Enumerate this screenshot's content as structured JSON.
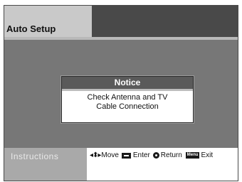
{
  "screen": {
    "title": "Auto Setup"
  },
  "notice": {
    "header": "Notice",
    "line1": "Check Antenna and TV",
    "line2": "Cable Connection"
  },
  "instructions": {
    "label": "Instructions",
    "move_icon": "up-down-left-right-arrows-icon",
    "move_label": "Move",
    "enter_icon": "enter-key-icon",
    "enter_label": "Enter",
    "return_icon": "return-button-icon",
    "return_label": "Return",
    "menu_key_label": "Menu",
    "exit_label": "Exit"
  }
}
